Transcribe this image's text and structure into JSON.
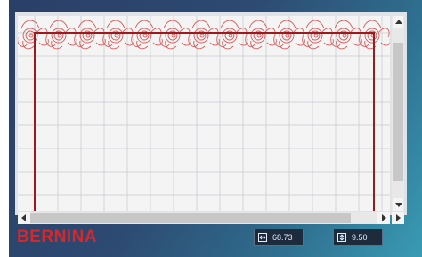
{
  "brand": {
    "name": "BERNINA",
    "color": "#d8272a"
  },
  "colors": {
    "hoop": "#9c1a1d",
    "stitch": "#d95a5a",
    "grid": "#cfd3d6"
  },
  "readouts": {
    "width": {
      "icon": "width-arrows-icon",
      "value": "68.73"
    },
    "height": {
      "icon": "height-arrows-icon",
      "value": "9.50"
    }
  },
  "scrollbars": {
    "vertical": {
      "icons": [
        "arrow-up-icon",
        "arrow-down-icon"
      ]
    },
    "horizontal": {
      "icons": [
        "arrow-left-icon",
        "arrow-right-icon"
      ]
    }
  }
}
